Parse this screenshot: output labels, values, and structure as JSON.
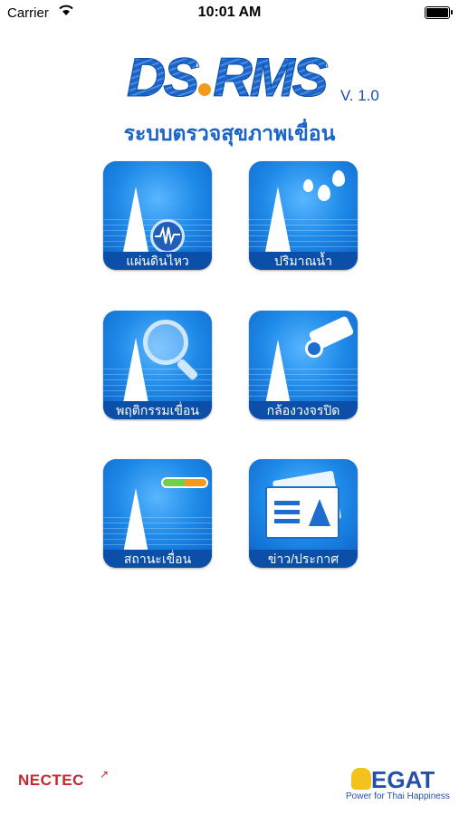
{
  "status_bar": {
    "carrier": "Carrier",
    "time": "10:01 AM"
  },
  "header": {
    "logo_left": "DS",
    "logo_right": "RMS",
    "version": "V. 1.0",
    "subtitle": "ระบบตรวจสุขภาพเขื่อน"
  },
  "tiles": [
    {
      "label": "แผ่นดินไหว",
      "icon": "seismograph-icon"
    },
    {
      "label": "ปริมาณน้ำ",
      "icon": "water-drops-icon"
    },
    {
      "label": "พฤติกรรมเขื่อน",
      "icon": "magnifier-icon"
    },
    {
      "label": "กล้องวงจรปิด",
      "icon": "cctv-camera-icon"
    },
    {
      "label": "สถานะเขื่อน",
      "icon": "status-indicator-icon"
    },
    {
      "label": "ข่าว/ประกาศ",
      "icon": "news-icon"
    }
  ],
  "footer": {
    "left_logo": "NECTEC",
    "right_logo": "EGAT",
    "right_tagline": "Power for Thai Happiness"
  },
  "colors": {
    "brand_blue": "#1a63c8",
    "accent_orange": "#f39a1d",
    "tile_label_bg": "#0b4fa8"
  }
}
